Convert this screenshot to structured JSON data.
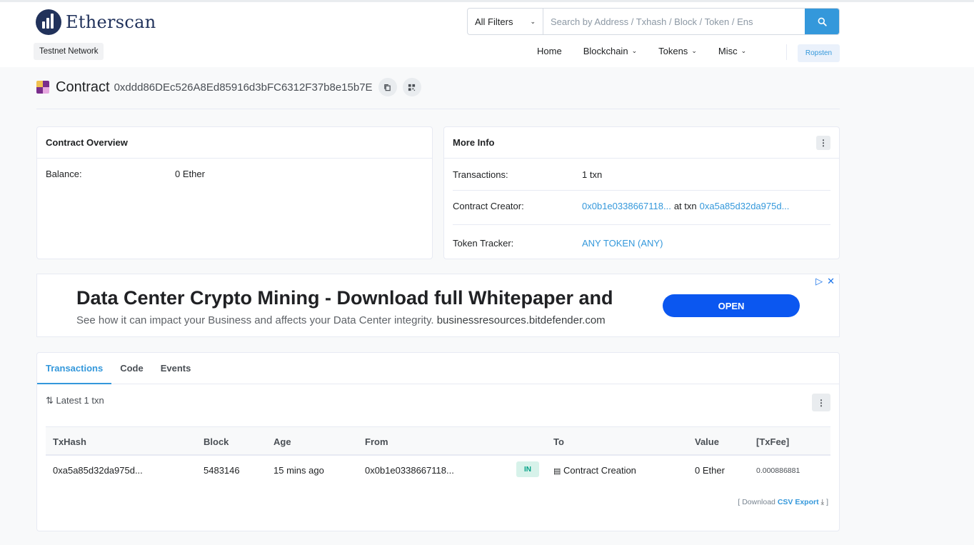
{
  "header": {
    "brand": "Etherscan",
    "network_badge": "Testnet Network",
    "search": {
      "filter_label": "All Filters",
      "placeholder": "Search by Address / Txhash / Block / Token / Ens"
    },
    "nav": {
      "home": "Home",
      "blockchain": "Blockchain",
      "tokens": "Tokens",
      "misc": "Misc"
    },
    "network_button": "Ropsten"
  },
  "contract": {
    "label": "Contract",
    "address": "0xddd86DEc526A8Ed85916d3bFC6312F37b8e15b7E"
  },
  "overview": {
    "title": "Contract Overview",
    "balance_label": "Balance:",
    "balance_value": "0 Ether"
  },
  "more_info": {
    "title": "More Info",
    "transactions_label": "Transactions:",
    "transactions_value": "1 txn",
    "creator_label": "Contract Creator:",
    "creator_address": "0x0b1e0338667118...",
    "at_txn": "at txn",
    "creator_txn": "0xa5a85d32da975d...",
    "token_tracker_label": "Token Tracker:",
    "token_tracker_value": "ANY TOKEN (ANY)"
  },
  "ad": {
    "title": "Data Center Crypto Mining - Download full Whitepaper and",
    "description": "See how it can impact your Business and affects your Data Center integrity.",
    "domain": "businessresources.bitdefender.com",
    "button": "OPEN"
  },
  "tabs": [
    "Transactions",
    "Code",
    "Events"
  ],
  "txn_section": {
    "latest": "Latest 1 txn",
    "columns": [
      "TxHash",
      "Block",
      "Age",
      "From",
      "To",
      "Value",
      "[TxFee]"
    ],
    "rows": [
      {
        "txhash": "0xa5a85d32da975d...",
        "block": "5483146",
        "age": "15 mins ago",
        "from": "0x0b1e0338667118...",
        "direction": "IN",
        "to": "Contract Creation",
        "value": "0 Ether",
        "txfee": "0.000886881"
      }
    ],
    "download_prefix": "[ Download",
    "csv_label": "CSV Export",
    "download_suffix": "]"
  },
  "colors": {
    "accent": "#3498db",
    "brand": "#21325b",
    "ad_button": "#0b57f0",
    "in_badge_bg": "#d7f2ea",
    "in_badge_text": "#00a186"
  }
}
